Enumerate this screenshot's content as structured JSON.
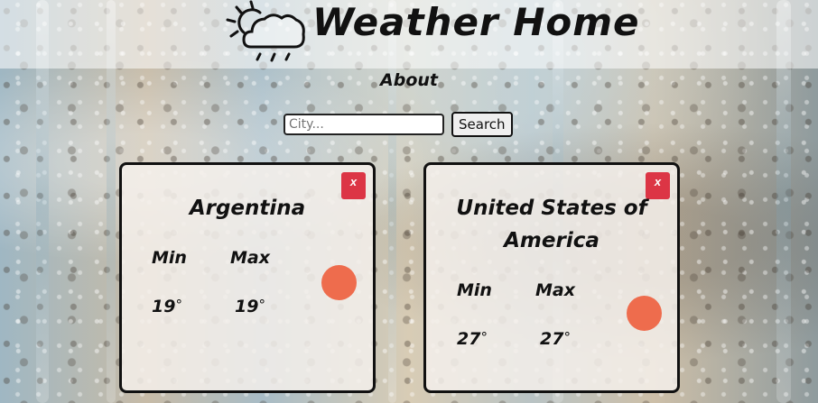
{
  "header": {
    "title": "Weather Home",
    "logo_icon": "cloud-sun-rain-icon"
  },
  "nav": {
    "about": "About"
  },
  "search": {
    "placeholder": "City...",
    "value": "",
    "button_label": "Search"
  },
  "cards": [
    {
      "city": "Argentina",
      "close_label": "x",
      "min_label": "Min",
      "max_label": "Max",
      "min_temp": "19",
      "max_temp": "19",
      "degree_symbol": "°",
      "indicator_color": "#ee6c4d"
    },
    {
      "city": "United States of America",
      "close_label": "x",
      "min_label": "Min",
      "max_label": "Max",
      "min_temp": "27",
      "max_temp": "27",
      "degree_symbol": "°",
      "indicator_color": "#ee6c4d"
    }
  ],
  "colors": {
    "close_button": "#dc3545",
    "indicator": "#ee6c4d",
    "text": "#111111"
  }
}
